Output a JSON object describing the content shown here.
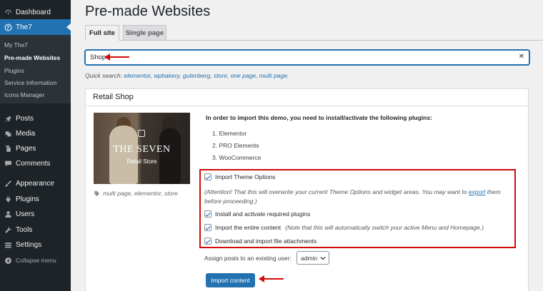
{
  "sidebar": {
    "items": [
      {
        "label": "Dashboard",
        "icon": "dashboard-icon"
      },
      {
        "label": "The7",
        "icon": "the7-icon"
      },
      {
        "label": "Posts",
        "icon": "pin-icon"
      },
      {
        "label": "Media",
        "icon": "media-icon"
      },
      {
        "label": "Pages",
        "icon": "pages-icon"
      },
      {
        "label": "Comments",
        "icon": "comments-icon"
      },
      {
        "label": "Appearance",
        "icon": "brush-icon"
      },
      {
        "label": "Plugins",
        "icon": "plug-icon"
      },
      {
        "label": "Users",
        "icon": "user-icon"
      },
      {
        "label": "Tools",
        "icon": "wrench-icon"
      },
      {
        "label": "Settings",
        "icon": "settings-icon"
      }
    ],
    "submenu": [
      "My The7",
      "Pre-made Websites",
      "Plugins",
      "Service Information",
      "Icons Manager"
    ],
    "collapse_label": "Collapse menu"
  },
  "page": {
    "title": "Pre-made Websites",
    "tabs": [
      "Full site",
      "Single page"
    ],
    "search_value": "Shop",
    "quick_search_label": "Quick search:",
    "quick_search_links": [
      "elementor",
      "wpbakery",
      "gutenberg",
      "store",
      "one page",
      "multi page"
    ]
  },
  "demo": {
    "title": "Retail Shop",
    "thumb_title": "THE SEVEN",
    "thumb_subtitle": "Retail Store",
    "tags": "multi page, elementor, store",
    "intro": "In order to import this demo, you need to install/activate the following plugins:",
    "plugins": [
      "1. Elementor",
      "2. PRO Elements",
      "3. WooCommerce"
    ],
    "options": {
      "theme_options": "Import Theme Options",
      "attention_before": "(Attention! That this will overwrite your current Theme Options and widget areas. You may want to ",
      "attention_link": "export",
      "attention_after": " them before proceeding.)",
      "install_plugins": "Install and activate required plugins",
      "import_content": "Import the entire content",
      "import_content_note": "(Note that this will automatically switch your active Menu and Homepage.)",
      "attachments": "Download and import file attachments"
    },
    "assign_label": "Assign posts to an existing user:",
    "assign_value": "admin",
    "import_button": "Import content"
  },
  "colors": {
    "accent": "#2271b1",
    "annotation": "#d30a0a",
    "sidebar": "#1d2327"
  }
}
